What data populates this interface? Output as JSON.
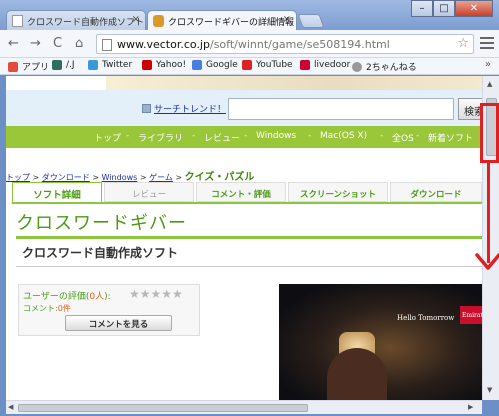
{
  "browser": {
    "tabs": [
      {
        "title": "クロスワード自動作成ソフト「",
        "active": false
      },
      {
        "title": "クロスワードギバーの詳細情報",
        "active": true
      }
    ],
    "url_domain": "www.vector.co.jp",
    "url_path": "/soft/winnt/game/se508194.html",
    "bookmarks": [
      {
        "label": "アプリ",
        "icon": "apps-grid-icon",
        "color": "#e34b3b"
      },
      {
        "label": "/.J",
        "icon": "slashdot-icon",
        "color": "#2e6e5e"
      },
      {
        "label": "Twitter",
        "icon": "twitter-bird-icon",
        "color": "#3a9ad9"
      },
      {
        "label": "Yahoo!",
        "icon": "yahoo-icon",
        "color": "#cc0000"
      },
      {
        "label": "Google",
        "icon": "google-icon",
        "color": "#4a7de0"
      },
      {
        "label": "YouTube",
        "icon": "youtube-icon",
        "color": "#d22"
      },
      {
        "label": "livedoor",
        "icon": "livedoor-icon",
        "color": "#c03"
      },
      {
        "label": "2ちゃんねる",
        "icon": "2ch-icon",
        "color": "#999"
      }
    ],
    "more": "»"
  },
  "page": {
    "trend_link": "サーチトレンド！",
    "search_button": "検索",
    "nav": [
      "トップ",
      "ライブラリ",
      "レビュー",
      "Windows",
      "Mac(OS X)",
      "全OS",
      "新着ソフト"
    ],
    "breadcrumb": {
      "items": [
        "トップ",
        "ダウンロード",
        "Windows",
        "ゲーム"
      ],
      "current": "クイズ・パズル"
    },
    "tabs": [
      "ソフト詳細",
      "レビュー",
      "コメント・評価",
      "スクリーンショット",
      "ダウンロード"
    ],
    "app_title": "クロスワードギバー",
    "subtitle": "クロスワード自動作成ソフト",
    "rating_label_pre": "ユーザーの評価(",
    "rating_count": "0人",
    "rating_label_post": "):",
    "stars": "★★★★★",
    "stars_value": 0,
    "comment_label": "コメント:",
    "comment_count": "0件",
    "see_comments_button": "コメントを見る",
    "ad_text": "Hello Tomorrow",
    "ad_logo": "Emirates"
  },
  "colors": {
    "brand_green": "#9ac63a",
    "link_blue": "#1a2fb0",
    "annotation_red": "#e02020"
  }
}
